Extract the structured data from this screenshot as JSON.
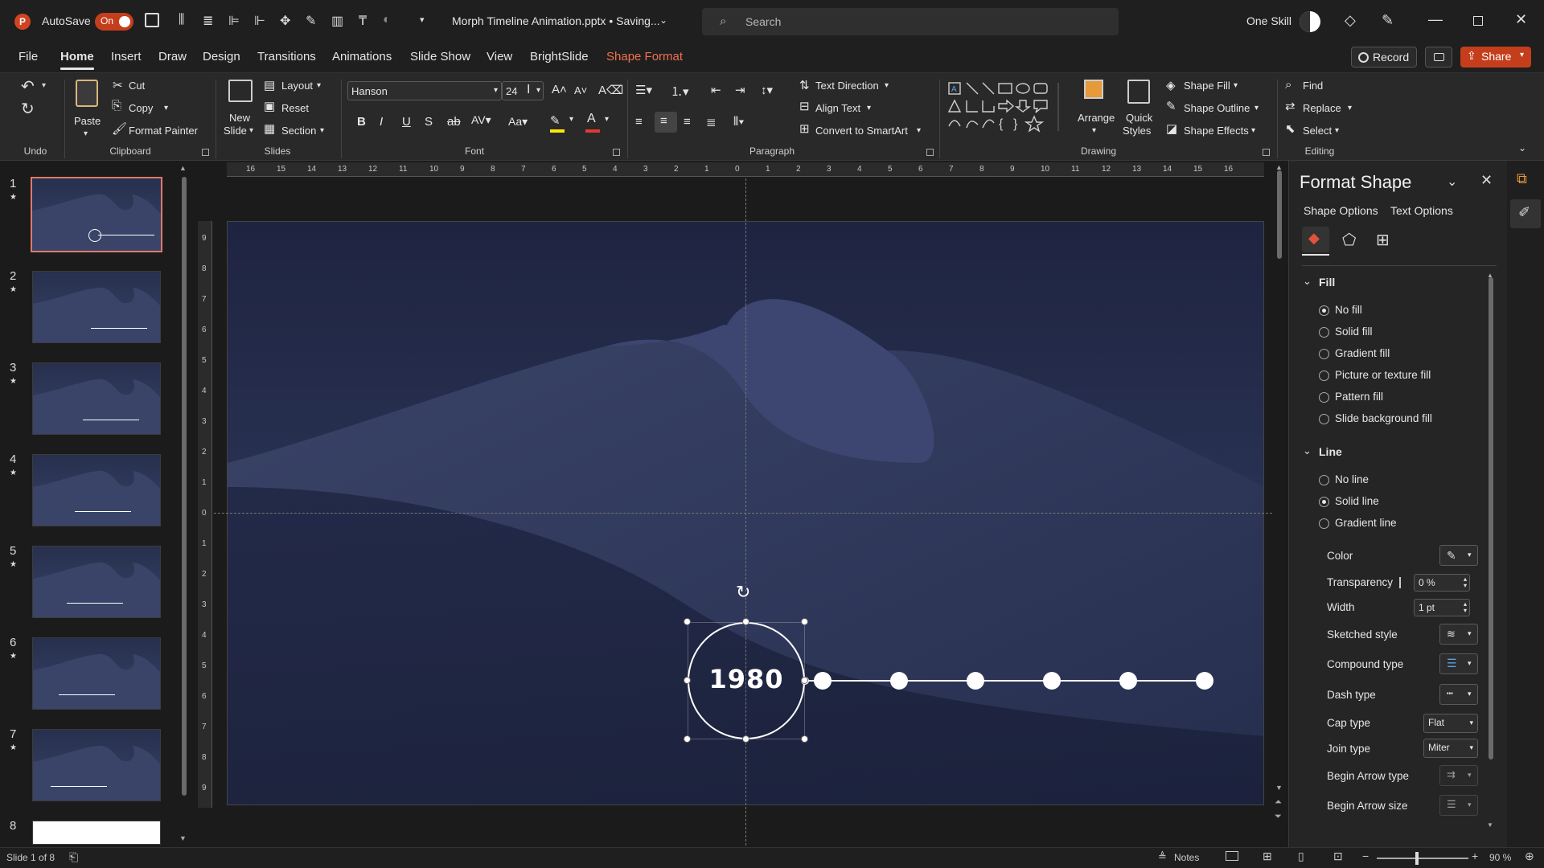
{
  "titlebar": {
    "autosave_label": "AutoSave",
    "autosave_state": "On",
    "file_title": "Morph Timeline Animation.pptx • Saving...",
    "search_placeholder": "Search",
    "user_name": "One Skill"
  },
  "menu": {
    "tabs": [
      "File",
      "Home",
      "Insert",
      "Draw",
      "Design",
      "Transitions",
      "Animations",
      "Slide Show",
      "View",
      "BrightSlide",
      "Shape Format"
    ],
    "record": "Record",
    "share": "Share"
  },
  "ribbon": {
    "groups": {
      "undo": "Undo",
      "clipboard": "Clipboard",
      "slides": "Slides",
      "font": "Font",
      "paragraph": "Paragraph",
      "drawing": "Drawing",
      "editing": "Editing"
    },
    "clipboard": {
      "paste": "Paste",
      "cut": "Cut",
      "copy": "Copy",
      "format_painter": "Format Painter"
    },
    "slides": {
      "new_slide_1": "New",
      "new_slide_2": "Slide",
      "layout": "Layout",
      "reset": "Reset",
      "section": "Section"
    },
    "font": {
      "name": "Hanson",
      "size": "24"
    },
    "paragraph": {
      "text_direction": "Text Direction",
      "align_text": "Align Text",
      "convert_smartart": "Convert to SmartArt"
    },
    "drawing": {
      "arrange": "Arrange",
      "quick_styles_1": "Quick",
      "quick_styles_2": "Styles",
      "shape_fill": "Shape Fill",
      "shape_outline": "Shape Outline",
      "shape_effects": "Shape Effects"
    },
    "editing": {
      "find": "Find",
      "replace": "Replace",
      "select": "Select"
    }
  },
  "thumbnails": [
    {
      "num": "1"
    },
    {
      "num": "2"
    },
    {
      "num": "3"
    },
    {
      "num": "4"
    },
    {
      "num": "5"
    },
    {
      "num": "6"
    },
    {
      "num": "7"
    },
    {
      "num": "8"
    }
  ],
  "ruler": {
    "h": [
      "16",
      "15",
      "14",
      "13",
      "12",
      "11",
      "10",
      "9",
      "8",
      "7",
      "6",
      "5",
      "4",
      "3",
      "2",
      "1",
      "0",
      "1",
      "2",
      "3",
      "4",
      "5",
      "6",
      "7",
      "8",
      "9",
      "10",
      "11",
      "12",
      "13",
      "14",
      "15",
      "16"
    ],
    "v": [
      "9",
      "8",
      "7",
      "6",
      "5",
      "4",
      "3",
      "2",
      "1",
      "0",
      "1",
      "2",
      "3",
      "4",
      "5",
      "6",
      "7",
      "8",
      "9"
    ]
  },
  "slide": {
    "year_text": "1980",
    "timeline_dots": 6
  },
  "format_shape": {
    "title": "Format Shape",
    "tab_shape": "Shape Options",
    "tab_text": "Text Options",
    "fill_header": "Fill",
    "fill_options": [
      "No fill",
      "Solid fill",
      "Gradient fill",
      "Picture or texture fill",
      "Pattern fill",
      "Slide background fill"
    ],
    "fill_selected": 0,
    "line_header": "Line",
    "line_options": [
      "No line",
      "Solid line",
      "Gradient line"
    ],
    "line_selected": 1,
    "props": {
      "color": "Color",
      "transparency": "Transparency",
      "transparency_value": "0 %",
      "width": "Width",
      "width_value": "1 pt",
      "sketched": "Sketched style",
      "compound": "Compound type",
      "dash": "Dash type",
      "cap": "Cap type",
      "cap_value": "Flat",
      "join": "Join type",
      "join_value": "Miter",
      "begin_arrow_type": "Begin Arrow type",
      "begin_arrow_size": "Begin Arrow size"
    }
  },
  "status": {
    "slide_info": "Slide 1 of 8",
    "notes": "Notes",
    "zoom": "90 %"
  }
}
